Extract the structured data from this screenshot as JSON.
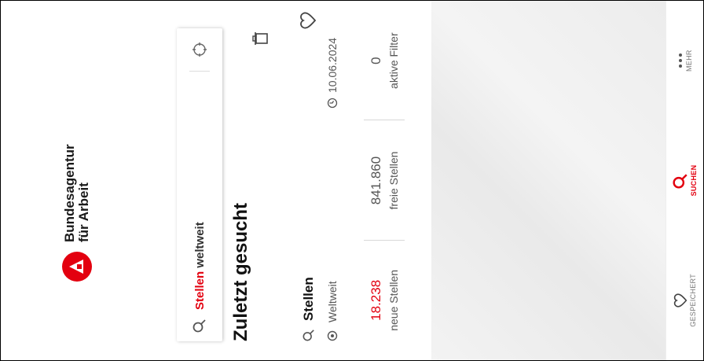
{
  "brand": {
    "line1": "Bundesagentur",
    "line2": "für Arbeit"
  },
  "search": {
    "red_word": "Stellen",
    "rest": " weltweit"
  },
  "recent": {
    "heading": "Zuletzt gesucht",
    "card": {
      "title": "Stellen",
      "location": "Weltweit",
      "date": "10.06.2024",
      "stats": [
        {
          "value": "18.238",
          "label": "neue Stellen"
        },
        {
          "value": "841.860",
          "label": "freie Stellen"
        },
        {
          "value": "0",
          "label": "aktive Filter"
        }
      ]
    }
  },
  "nav": [
    {
      "label": "GESPEICHERT",
      "icon": "heart-icon"
    },
    {
      "label": "SUCHEN",
      "icon": "search-icon"
    },
    {
      "label": "MEHR",
      "icon": "more-icon"
    }
  ],
  "colors": {
    "accent": "#e3000f"
  }
}
